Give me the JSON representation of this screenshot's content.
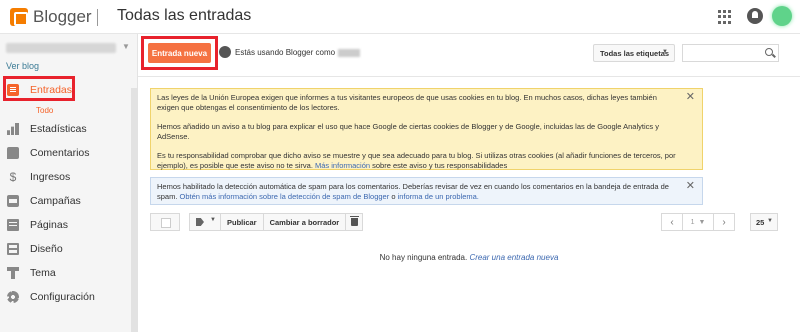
{
  "header": {
    "brand": "Blogger",
    "title": "Todas las entradas"
  },
  "sidebar": {
    "view_blog": "Ver blog",
    "items": [
      {
        "label": "Entradas",
        "icon": "posts-icon",
        "active": true
      },
      {
        "label": "Estadísticas",
        "icon": "stats-icon"
      },
      {
        "label": "Comentarios",
        "icon": "comments-icon"
      },
      {
        "label": "Ingresos",
        "icon": "earnings-icon"
      },
      {
        "label": "Campañas",
        "icon": "campaigns-icon"
      },
      {
        "label": "Páginas",
        "icon": "pages-icon"
      },
      {
        "label": "Diseño",
        "icon": "layout-icon"
      },
      {
        "label": "Tema",
        "icon": "theme-icon"
      },
      {
        "label": "Configuración",
        "icon": "settings-icon"
      }
    ],
    "subitem": "Todo"
  },
  "toolbar": {
    "new_post": "Entrada nueva",
    "using_as": "Estás usando Blogger como",
    "labels_filter": "Todas las etiquetas"
  },
  "notices": {
    "cookie": {
      "p1": "Las leyes de la Unión Europea exigen que informes a tus visitantes europeos de que usas cookies en tu blog. En muchos casos, dichas leyes también exigen que obtengas el consentimiento de los lectores.",
      "p2": "Hemos añadido un aviso a tu blog para explicar el uso que hace Google de ciertas cookies de Blogger y de Google, incluidas las de Google Analytics y AdSense.",
      "p3_start": "Es tu responsabilidad comprobar que dicho aviso se muestre y que sea adecuado para tu blog. Si utilizas otras cookies (al añadir funciones de terceros, por ejemplo), es posible que este aviso no te sirva.",
      "p3_link": "Más información",
      "p3_end": "sobre este aviso y tus responsabilidades"
    },
    "spam": {
      "text": "Hemos habilitado la detección automática de spam para los comentarios. Deberías revisar de vez en cuando los comentarios en la bandeja de entrada de spam.",
      "link1": "Obtén más información sobre la detección de spam de Blogger",
      "mid": "o",
      "link2": "informa de un problema."
    },
    "close": "✕"
  },
  "post_toolbar": {
    "publish": "Publicar",
    "to_draft": "Cambiar a borrador",
    "page": "1",
    "per_page": "25"
  },
  "empty": {
    "text": "No hay ninguna entrada.",
    "link": "Crear una entrada nueva"
  },
  "colors": {
    "accent": "#f5632a",
    "new_post_bg": "#f57242",
    "highlight": "#e8222c",
    "cookie_notice_bg": "#fdf2c4",
    "spam_notice_bg": "#eef4fb",
    "link": "#3c68b0"
  }
}
